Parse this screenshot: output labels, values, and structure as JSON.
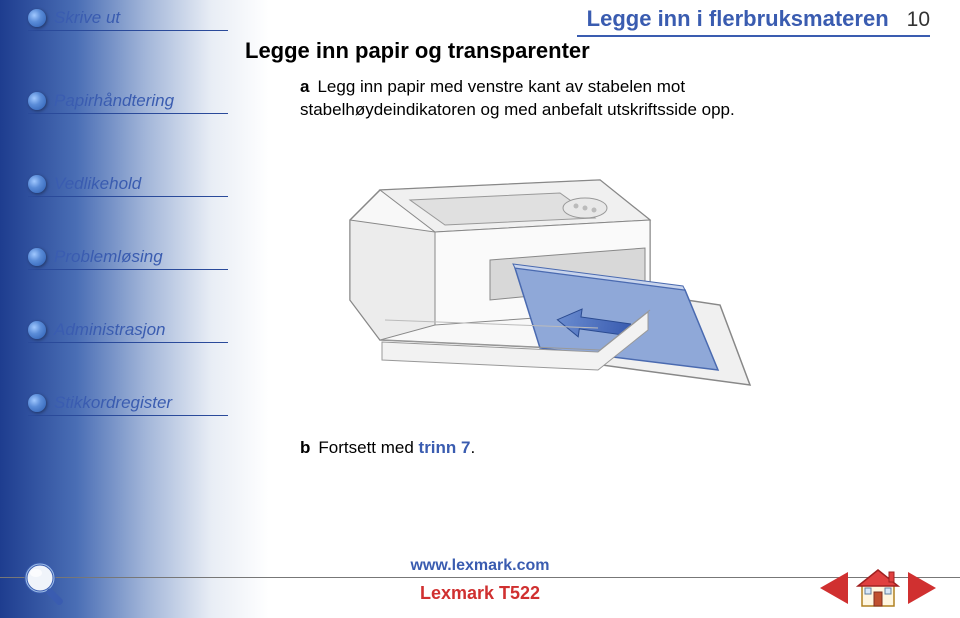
{
  "sidebar": {
    "items": [
      {
        "label": "Skrive ut"
      },
      {
        "label": "Papirhåndtering"
      },
      {
        "label": "Vedlikehold"
      },
      {
        "label": "Problemløsing"
      },
      {
        "label": "Administrasjon"
      },
      {
        "label": "Stikkordregister"
      }
    ]
  },
  "header": {
    "title": "Legge inn i flerbruksmateren",
    "page_number": "10"
  },
  "section": {
    "heading": "Legge inn papir og transparenter"
  },
  "body": {
    "a_letter": "a",
    "a_text": "Legg inn papir med venstre kant av stabelen mot stabelhøydeindikatoren og med anbefalt utskriftsside opp.",
    "b_letter": "b",
    "b_text_prefix": "Fortsett med ",
    "b_link": "trinn 7",
    "b_text_suffix": "."
  },
  "footer": {
    "url": "www.lexmark.com",
    "product": "Lexmark T522"
  }
}
